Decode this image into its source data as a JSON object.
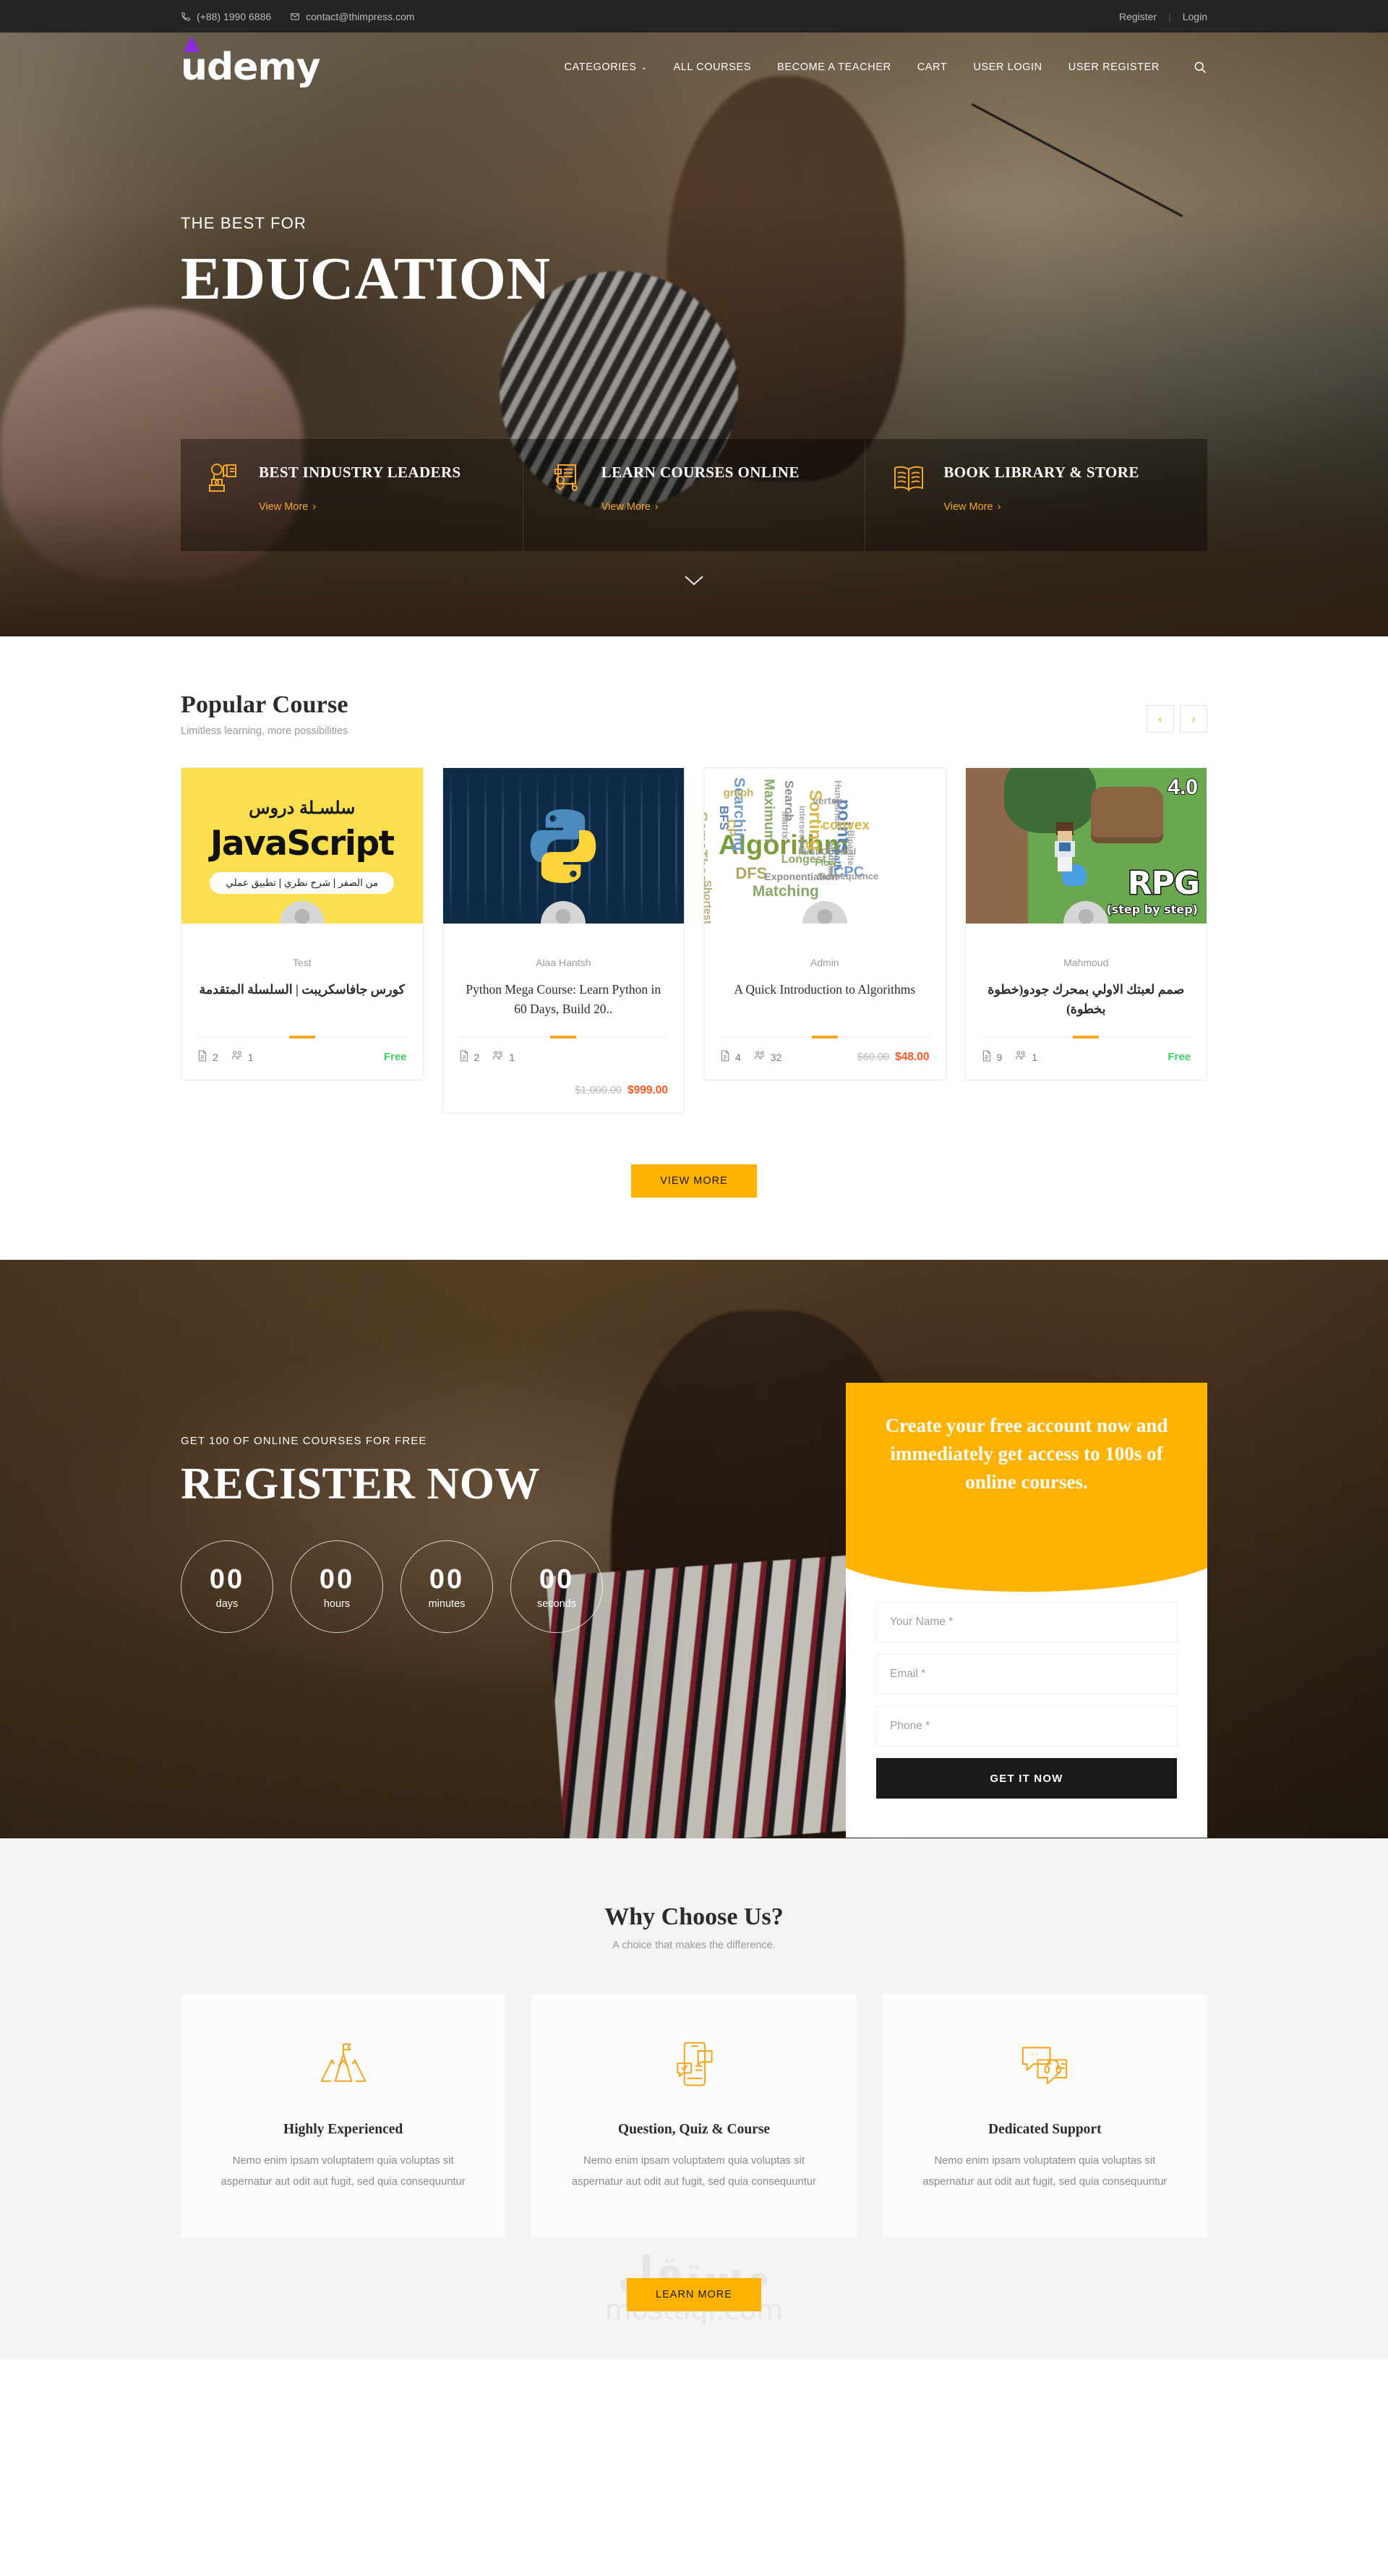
{
  "topbar": {
    "phone": "(+88) 1990 6886",
    "email": "contact@thimpress.com",
    "phone_icon": "phone-icon",
    "email_icon": "envelope-icon",
    "register": "Register",
    "separator": "|",
    "login": "Login"
  },
  "header": {
    "logo_text": "udemy",
    "nav": [
      {
        "label": "CATEGORIES",
        "caret": "⌄"
      },
      {
        "label": "ALL COURSES"
      },
      {
        "label": "BECOME A TEACHER"
      },
      {
        "label": "CART"
      },
      {
        "label": "USER LOGIN"
      },
      {
        "label": "USER REGISTER"
      }
    ],
    "search_icon": "search-icon"
  },
  "hero": {
    "kicker": "THE BEST FOR",
    "title": "EDUCATION",
    "scroll_icon": "chevron-down-icon",
    "features": [
      {
        "icon": "teacher-book-icon",
        "title": "BEST INDUSTRY LEADERS",
        "link": "View More",
        "arrow": "›"
      },
      {
        "icon": "graduate-certificate-icon",
        "title": "LEARN COURSES ONLINE",
        "link": "View More",
        "arrow": "›"
      },
      {
        "icon": "open-book-icon",
        "title": "BOOK LIBRARY & STORE",
        "link": "View More",
        "arrow": "›"
      }
    ]
  },
  "courses": {
    "title": "Popular Course",
    "subtitle": "Limitless learning, more possibilities",
    "prev_icon": "chevron-left-icon",
    "next_icon": "chevron-right-icon",
    "view_more": "VIEW MORE",
    "items": [
      {
        "thumb_type": "javascript",
        "thumb_arabic_top": "سلسـلة دروس",
        "thumb_main": "JavaScript",
        "thumb_pill": "من الصفر | شرح نظري | تطبيق عملي",
        "author": "Test",
        "title": "كورس جافاسكريبت | السلسلة المتقدمة",
        "rtl": true,
        "lessons": "2",
        "students": "1",
        "price_free": "Free",
        "price_old": "",
        "price_new": "",
        "lesson_icon": "document-icon",
        "student_icon": "users-icon"
      },
      {
        "thumb_type": "python",
        "author": "Alaa Hantsh",
        "title": "Python Mega Course: Learn Python in 60 Days, Build 20..",
        "rtl": false,
        "lessons": "2",
        "students": "1",
        "price_free": "",
        "price_old": "$1,000.00",
        "price_new": "$999.00",
        "lesson_icon": "document-icon",
        "student_icon": "users-icon"
      },
      {
        "thumb_type": "algorithm",
        "author": "Admin",
        "title": "A Quick Introduction to Algorithms",
        "rtl": false,
        "lessons": "4",
        "students": "32",
        "price_free": "",
        "price_old": "$60.00",
        "price_new": "$48.00",
        "lesson_icon": "document-icon",
        "student_icon": "users-icon"
      },
      {
        "thumb_type": "rpg",
        "thumb_main": "RPG",
        "thumb_sub": "(step by step)",
        "thumb_badge": "4.0",
        "author": "Mahmoud",
        "title": "صمم لعبتك الاولي بمحرك جودو(خطوة بخطوة)",
        "rtl": true,
        "lessons": "9",
        "students": "1",
        "price_free": "Free",
        "price_old": "",
        "price_new": "",
        "lesson_icon": "document-icon",
        "student_icon": "users-icon"
      }
    ]
  },
  "register": {
    "kicker": "GET 100 OF ONLINE COURSES FOR FREE",
    "title": "REGISTER NOW",
    "countdown": [
      {
        "value": "00",
        "label": "days"
      },
      {
        "value": "00",
        "label": "hours"
      },
      {
        "value": "00",
        "label": "minutes"
      },
      {
        "value": "00",
        "label": "seconds"
      }
    ],
    "card_heading": "Create your free account now and immediately get access to 100s of online courses.",
    "form": {
      "name_placeholder": "Your Name *",
      "name_value": "",
      "email_placeholder": "Email *",
      "email_value": "",
      "phone_placeholder": "Phone *",
      "phone_value": "",
      "submit": "GET IT NOW"
    }
  },
  "why": {
    "title": "Why Choose Us?",
    "subtitle": "A choice that makes the difference.",
    "cards": [
      {
        "icon": "mountain-flag-icon",
        "title": "Highly Experienced",
        "text": "Nemo enim ipsam voluptatem quia voluptas sit aspernatur aut odit aut fugit, sed quia consequuntur"
      },
      {
        "icon": "mobile-quiz-icon",
        "title": "Question, Quiz & Course",
        "text": "Nemo enim ipsam voluptatem quia voluptas sit aspernatur aut odit aut fugit, sed quia consequuntur"
      },
      {
        "icon": "support-chat-icon",
        "title": "Dedicated Support",
        "text": "Nemo enim ipsam voluptatem quia voluptas sit aspernatur aut odit aut fugit, sed quia consequuntur"
      }
    ],
    "learn_more": "LEARN MORE",
    "watermark_arabic": "مستقل",
    "watermark_latin": "mostaql.com"
  },
  "colors": {
    "accent_yellow": "#FFB300",
    "link_orange": "#F5A623",
    "price_orange": "#FF5722",
    "free_green": "#3ED160",
    "dark": "#242424",
    "logo_purple": "#8A2BE2"
  }
}
